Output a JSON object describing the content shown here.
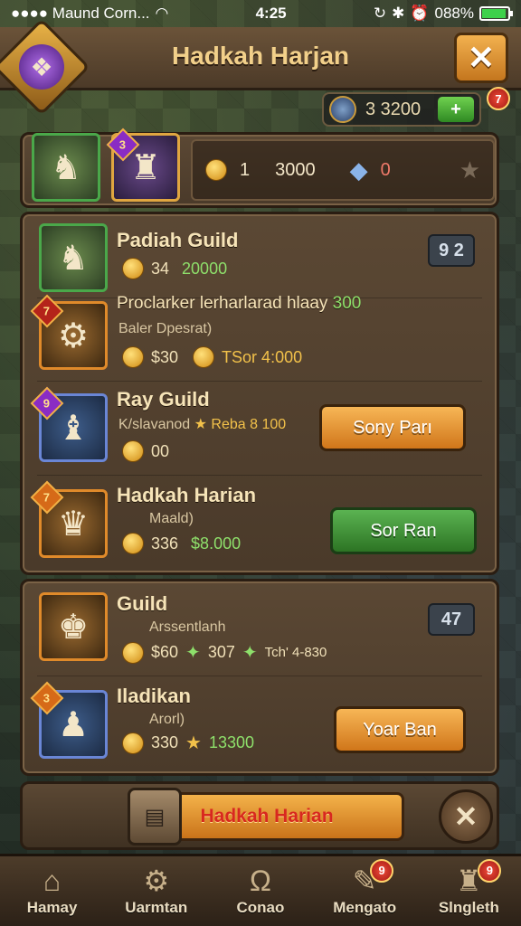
{
  "status_bar": {
    "carrier": "●●●● Maund Corn...",
    "time": "4:25",
    "battery_text": "088%",
    "battery_level": 0.88
  },
  "header": {
    "title": "Hadkah Harjan",
    "avatar_icon": "crystal-hero-icon",
    "close_icon": "crossed-swords-icon"
  },
  "currency": {
    "value": "3 3200",
    "plus_icon": "plus-icon",
    "notification": "7"
  },
  "resources": {
    "hero1_badge": "",
    "hero2_badge": "3",
    "gold_count": "1",
    "gold_total": "3000",
    "gem_count": "0"
  },
  "guilds_section_1": [
    {
      "title": "Padiah Guild",
      "stat_a": "34",
      "stat_b": "20000",
      "level": "9 2",
      "badge": ""
    },
    {
      "title": "Proclarker lerharlarad hlaay",
      "title_highlight": "300",
      "subtitle": "Baler Dpesrat)",
      "stat_a": "$30",
      "stat_b": "TSor 4:000",
      "badge": "7"
    },
    {
      "title": "Ray Guild",
      "subtitle": "K/slavanod",
      "subtitle_extra": "Reba 8 100",
      "stat_a": "00",
      "button": "Sony Parı",
      "badge": "9"
    },
    {
      "title": "Hadkah Harian",
      "subtitle": "Maald)",
      "stat_a": "336",
      "stat_b": "$8.000",
      "button": "Sor Ran",
      "badge": "7"
    }
  ],
  "guilds_section_2": [
    {
      "title": "Guild",
      "subtitle": "Arssentlanh",
      "stat_a": "$60",
      "stat_b": "307",
      "stat_c": "Tch' 4-830",
      "level": "47"
    },
    {
      "title": "Iladikan",
      "subtitle": "Arorl)",
      "stat_a": "330",
      "stat_b": "13300",
      "button": "Yoar Ban",
      "badge": "3"
    }
  ],
  "action_bar": {
    "main_button": "Hadkah Harian",
    "close_label": "✕"
  },
  "bottom_nav": [
    {
      "label": "Hamay",
      "icon": "house-icon",
      "badge": ""
    },
    {
      "label": "Uarmtan",
      "icon": "gear-icon",
      "badge": ""
    },
    {
      "label": "Conao",
      "icon": "horseshoe-icon",
      "badge": ""
    },
    {
      "label": "Mengato",
      "icon": "scroll-icon",
      "badge": "9"
    },
    {
      "label": "Slngleth",
      "icon": "sack-icon",
      "badge": "9"
    }
  ]
}
